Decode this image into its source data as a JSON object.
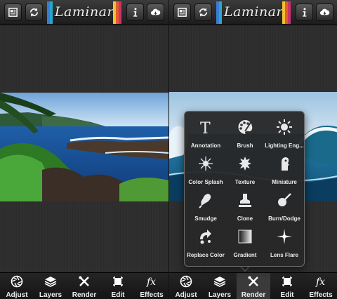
{
  "app": {
    "logo_text": "Laminar"
  },
  "header": {
    "stripe_colors": [
      "#3a7bd5",
      "#2aa6c9",
      "#f2c12e",
      "#e45b2a",
      "#c9336b"
    ]
  },
  "bottom_nav": {
    "items": [
      {
        "label": "Adjust",
        "icon": "aperture-icon"
      },
      {
        "label": "Layers",
        "icon": "layers-icon"
      },
      {
        "label": "Render",
        "icon": "tools-icon"
      },
      {
        "label": "Edit",
        "icon": "crop-icon"
      },
      {
        "label": "Effects",
        "icon": "fx-icon"
      }
    ]
  },
  "render_menu": {
    "tools": [
      {
        "label": "Annotation",
        "icon": "text-t-icon"
      },
      {
        "label": "Brush",
        "icon": "palette-icon"
      },
      {
        "label": "Lighting Eng...",
        "icon": "sun-icon"
      },
      {
        "label": "Color Splash",
        "icon": "burst-icon"
      },
      {
        "label": "Texture",
        "icon": "leaves-icon"
      },
      {
        "label": "Miniature",
        "icon": "miniature-icon"
      },
      {
        "label": "Smudge",
        "icon": "smudge-icon"
      },
      {
        "label": "Clone",
        "icon": "stamp-icon"
      },
      {
        "label": "Burn/Dodge",
        "icon": "dodge-icon"
      },
      {
        "label": "Replace Color",
        "icon": "replace-icon"
      },
      {
        "label": "Gradient",
        "icon": "gradient-icon"
      },
      {
        "label": "Lens Flare",
        "icon": "flare-icon"
      }
    ]
  }
}
